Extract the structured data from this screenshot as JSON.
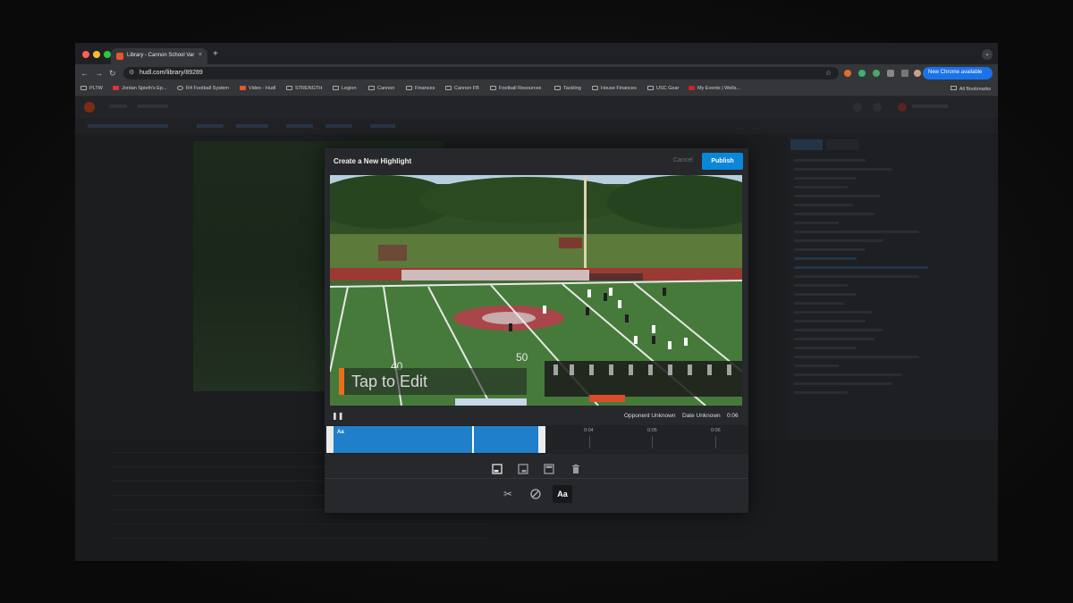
{
  "browser": {
    "tab_title": "Library - Cannon School Var",
    "url": "hudl.com/library/89289",
    "new_chrome_label": "New Chrome available",
    "bookmarks": [
      "PLTW",
      "Jordan Spieth's Ep...",
      "R4 Football System",
      "Video - Hudl",
      "STRENGTH",
      "Legion",
      "Cannon",
      "Finances",
      "Cannon FB",
      "Football Resources",
      "Tackling",
      "House Finances",
      "USC Gear",
      "My Events | Wells..."
    ],
    "all_bookmarks_label": "All Bookmarks"
  },
  "modal": {
    "title": "Create a New Highlight",
    "cancel_label": "Cancel",
    "publish_label": "Publish",
    "caption_text": "Tap to Edit",
    "opponent": "Opponent Unknown",
    "date": "Date Unknown",
    "duration": "0:06",
    "clip_label": "Aa",
    "timeline_ticks": [
      "0:04",
      "0:05",
      "0:06"
    ],
    "text_tool_label": "Aa"
  },
  "icons": {
    "scissors": "✂",
    "pause": "❚❚",
    "reload": "↻",
    "back": "←",
    "forward": "→",
    "star": "☆",
    "close": "×",
    "plus": "+",
    "chevron": "⌄"
  },
  "colors": {
    "publish": "#0b87d8",
    "clip": "#1f7fcb",
    "caption_accent": "#e8701a"
  }
}
